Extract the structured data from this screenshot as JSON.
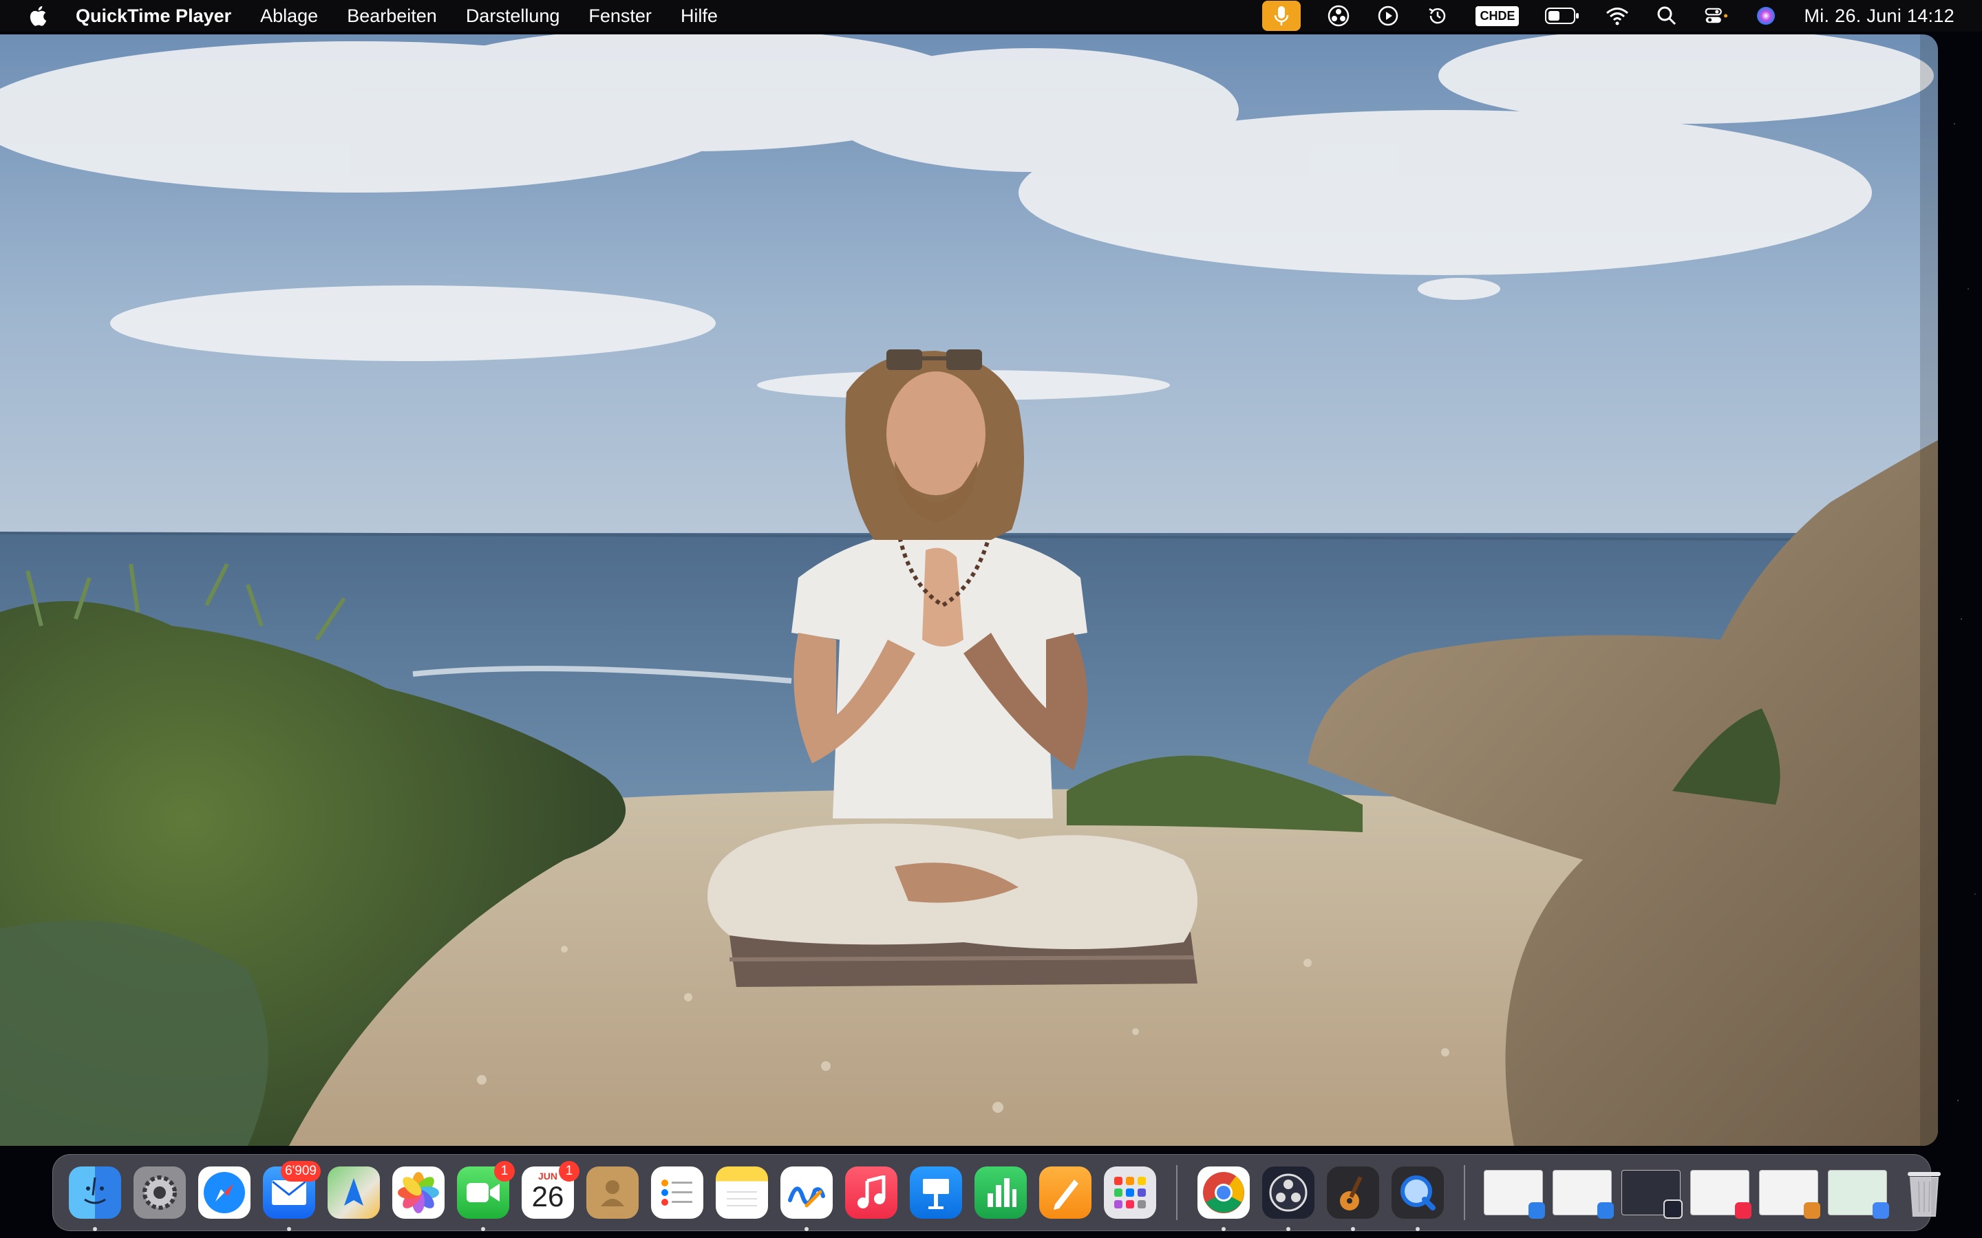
{
  "menubar": {
    "app_name": "QuickTime Player",
    "items": [
      "Ablage",
      "Bearbeiten",
      "Darstellung",
      "Fenster",
      "Hilfe"
    ],
    "input_source": "CHDE",
    "datetime": "Mi. 26. Juni  14:12"
  },
  "dock": {
    "mail_badge": "6'909",
    "facetime_badge": "1",
    "calendar_badge": "1",
    "calendar_month": "JUN",
    "calendar_day": "26"
  },
  "colors": {
    "menubar_bg": "#0b0b0d",
    "mic_active": "#f2a31d",
    "badge": "#ff3b30"
  }
}
